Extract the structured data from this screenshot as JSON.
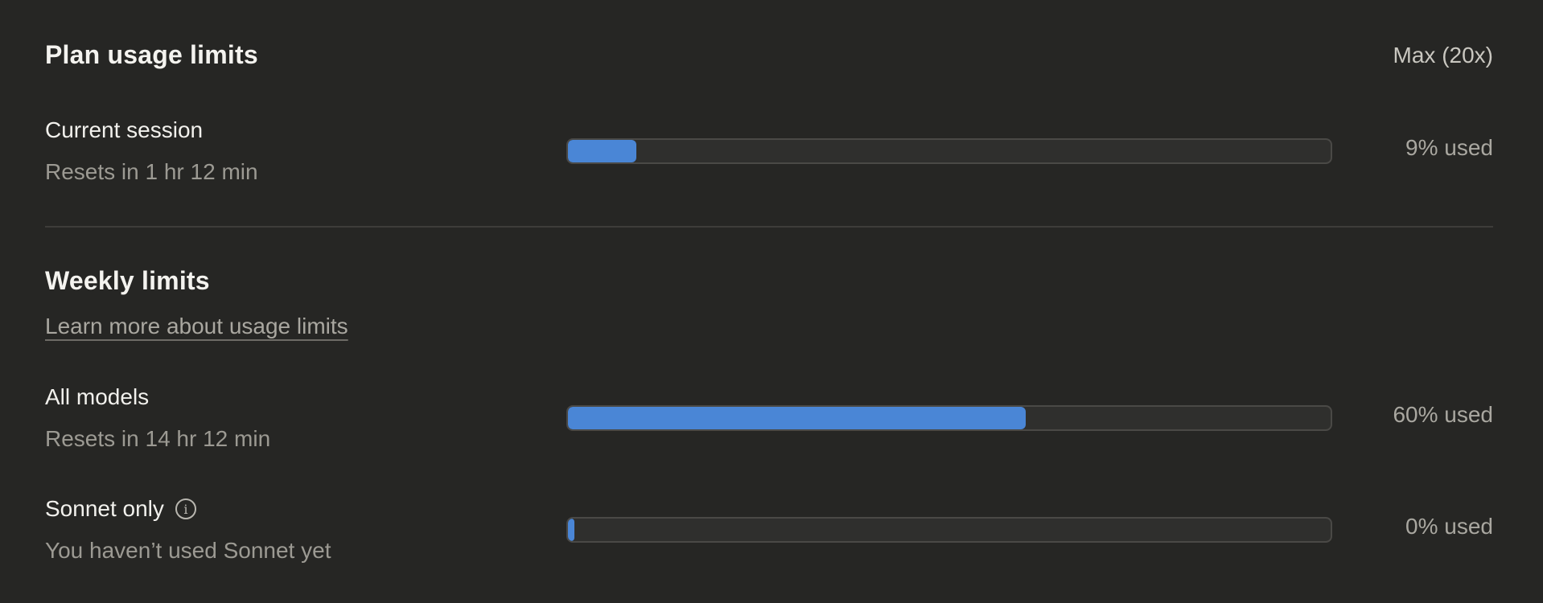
{
  "plan_section": {
    "title": "Plan usage limits",
    "plan_badge": "Max (20x)",
    "current_session": {
      "label": "Current session",
      "reset_text": "Resets in 1 hr 12 min",
      "usage_percent": 9,
      "usage_text": "9% used"
    }
  },
  "weekly_section": {
    "title": "Weekly limits",
    "learn_more_link": "Learn more about usage limits",
    "all_models": {
      "label": "All models",
      "reset_text": "Resets in 14 hr 12 min",
      "usage_percent": 60,
      "usage_text": "60% used"
    },
    "sonnet_only": {
      "label": "Sonnet only",
      "info_icon": "info-icon",
      "reset_text": "You haven’t used Sonnet yet",
      "usage_percent": 0,
      "usage_text": "0% used"
    }
  },
  "colors": {
    "background": "#262624",
    "bar_fill": "#4a86d6",
    "bar_track": "#2f2f2d"
  }
}
